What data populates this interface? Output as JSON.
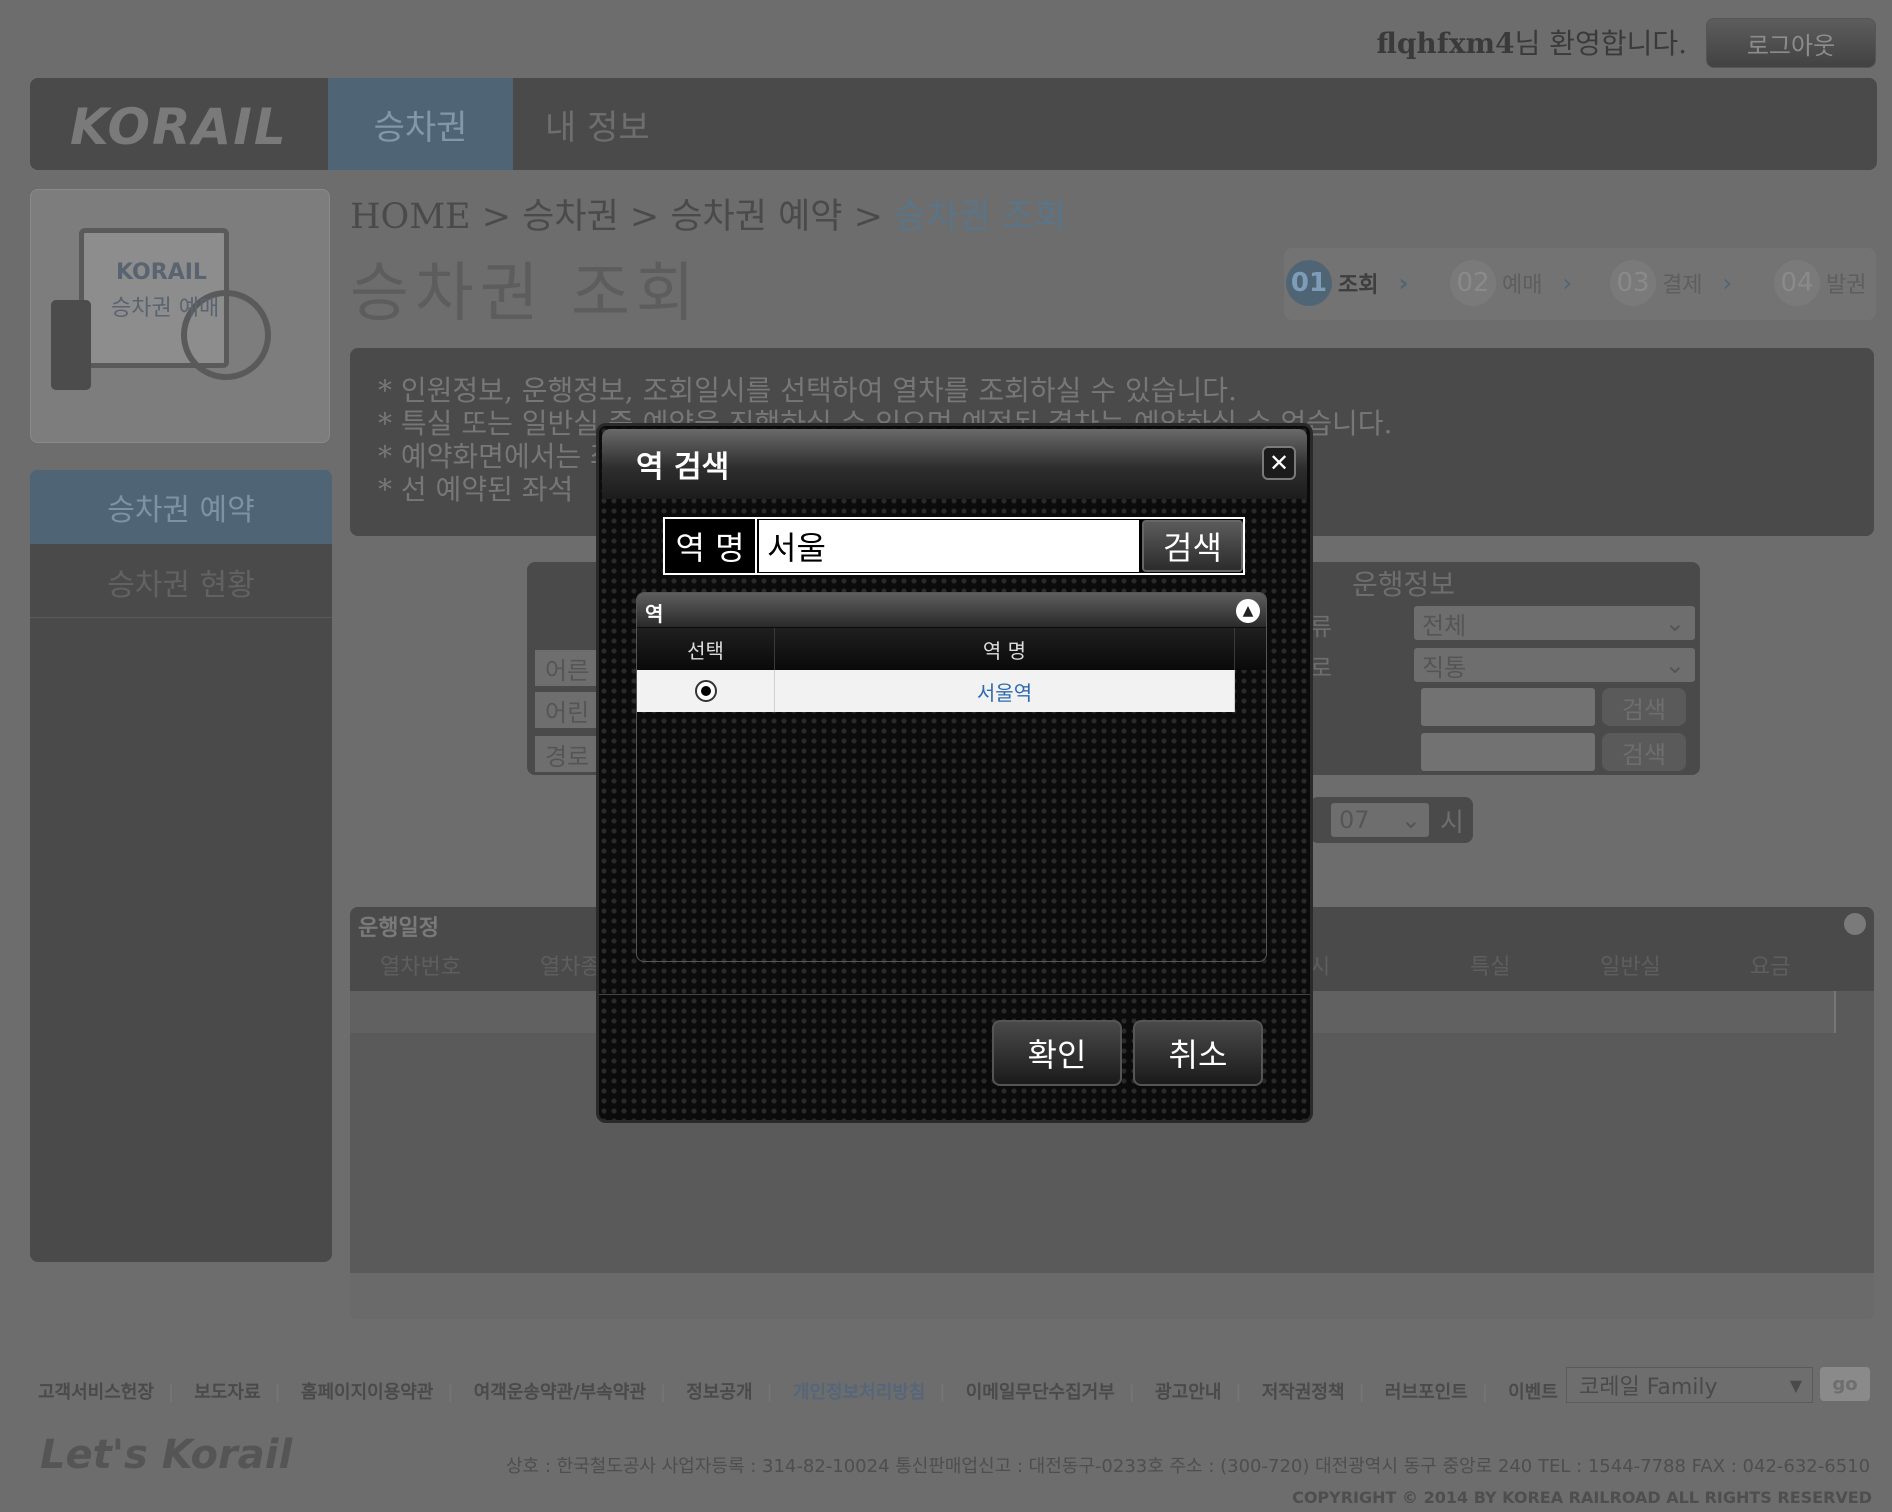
{
  "header": {
    "username": "flqhfxm4",
    "welcome_suffix": "님 환영합니다.",
    "logout_label": "로그아웃",
    "logo": "KORAIL",
    "nav": [
      "승차권",
      "내 정보"
    ]
  },
  "sidebar": {
    "banner_line1": "KORAIL",
    "banner_line2": "승차권 예매",
    "items": [
      "승차권 예약",
      "승차권 현황"
    ]
  },
  "breadcrumb": {
    "prefix": "HOME > 승차권 > 승차권 예약 > ",
    "current": "승차권 조회"
  },
  "page_title": "승차권 조회",
  "steps": [
    {
      "num": "01",
      "label": "조회"
    },
    {
      "num": "02",
      "label": "예매"
    },
    {
      "num": "03",
      "label": "결제"
    },
    {
      "num": "04",
      "label": "발권"
    }
  ],
  "notices": [
    "* 인원정보, 운행정보, 조회일시를 선택하여 열차를 조회하실 수 있습니다.",
    "* 특실 또는 일반실 중 예약을 진행하실 수 있으며 예정된 결차는 예약하실 수 없습니다.",
    "* 예약화면에서는 좌석선택 후 좌석을 선택하여 예약을 진행하실 수 있습니다.",
    "* 선 예약된 좌석"
  ],
  "form": {
    "passengers": [
      "어른",
      "어린",
      "경로"
    ],
    "service_header": "운행정보",
    "type_label": "류",
    "route_label": "로",
    "type_value": "전체",
    "route_value": "직통",
    "search_label": "검색",
    "hour_value": "07",
    "hour_unit": "시"
  },
  "schedule": {
    "title": "운행일정",
    "columns": [
      "열차번호",
      "열차종",
      "시",
      "특실",
      "일반실",
      "요금"
    ]
  },
  "footer": {
    "links": [
      "고객서비스헌장",
      "보도자료",
      "홈페이지이용약관",
      "여객운송약관/부속약관",
      "정보공개",
      "개인정보처리방침",
      "이메일무단수집거부",
      "광고안내",
      "저작권정책",
      "러브포인트",
      "이벤트"
    ],
    "family_label": "코레일 Family",
    "go_label": "go",
    "brand": "Let's Korail",
    "corp_info": "상호 : 한국철도공사    사업자등록 : 314-82-10024    통신판매업신고 : 대전동구-0233호    주소 : (300-720) 대전광역시 동구 중앙로 240    TEL : 1544-7788    FAX : 042-632-6510",
    "copyright": "COPYRIGHT © 2014 BY KOREA RAILROAD  ALL RIGHTS RESERVED"
  },
  "modal": {
    "title": "역 검색",
    "close_glyph": "✕",
    "field_label": "역 명",
    "search_value": "서울",
    "search_button": "검색",
    "grid_title": "역",
    "grid_columns": [
      "선택",
      "역 명"
    ],
    "results": [
      {
        "name": "서울역",
        "selected": true
      }
    ],
    "confirm_label": "확인",
    "cancel_label": "취소"
  }
}
